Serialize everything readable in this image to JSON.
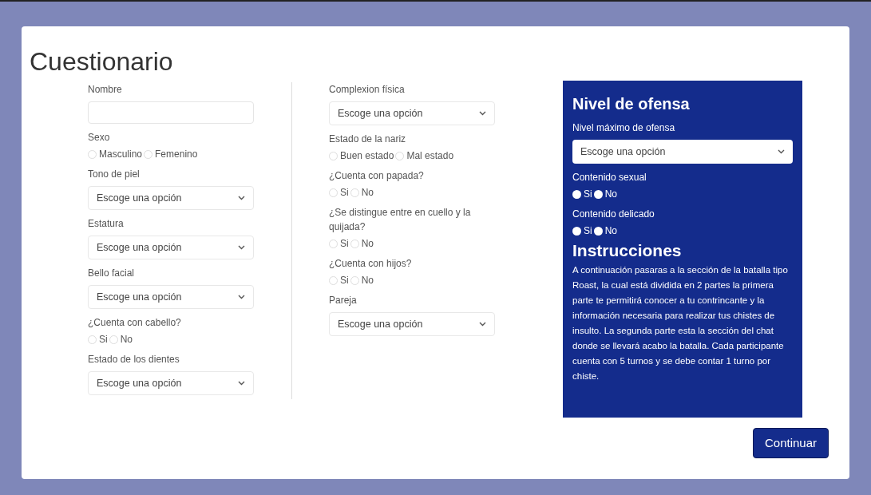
{
  "title": "Cuestionario",
  "columns": [
    [
      {
        "kind": "text",
        "label": "Nombre"
      },
      {
        "kind": "radio",
        "label": "Sexo",
        "options": [
          {
            "label": "Masculino",
            "checked": false
          },
          {
            "label": "Femenino",
            "checked": false
          }
        ]
      },
      {
        "kind": "select",
        "label": "Tono de piel",
        "placeholder": "Escoge una opción"
      },
      {
        "kind": "select",
        "label": "Estatura",
        "placeholder": "Escoge una opción"
      },
      {
        "kind": "select",
        "label": "Bello facial",
        "placeholder": "Escoge una opción"
      },
      {
        "kind": "radio",
        "label": "¿Cuenta con cabello?",
        "options": [
          {
            "label": "Si",
            "checked": false
          },
          {
            "label": "No",
            "checked": false
          }
        ]
      },
      {
        "kind": "select",
        "label": "Estado de los dientes",
        "placeholder": "Escoge una opción"
      }
    ],
    [
      {
        "kind": "select",
        "label": "Complexion física",
        "placeholder": "Escoge una opción"
      },
      {
        "kind": "radio",
        "label": "Estado de la nariz",
        "options": [
          {
            "label": "Buen estado",
            "checked": false
          },
          {
            "label": "Mal estado",
            "checked": false
          }
        ]
      },
      {
        "kind": "radio",
        "label": "¿Cuenta con papada?",
        "options": [
          {
            "label": "Si",
            "checked": false
          },
          {
            "label": "No",
            "checked": false
          }
        ]
      },
      {
        "kind": "radio",
        "label": "¿Se distingue entre en cuello y la quijada?",
        "options": [
          {
            "label": "Si",
            "checked": false
          },
          {
            "label": "No",
            "checked": false
          }
        ]
      },
      {
        "kind": "radio",
        "label": "¿Cuenta con hijos?",
        "options": [
          {
            "label": "Si",
            "checked": false
          },
          {
            "label": "No",
            "checked": false
          }
        ]
      },
      {
        "kind": "select",
        "label": "Pareja",
        "placeholder": "Escoge una opción"
      }
    ]
  ],
  "panel": {
    "heading": "Nivel de ofensa",
    "fields": [
      {
        "kind": "select",
        "label": "Nivel máximo de ofensa",
        "placeholder": "Escoge una opción"
      },
      {
        "kind": "radio",
        "label": "Contenido sexual",
        "options": [
          {
            "label": "Si",
            "checked": false
          },
          {
            "label": "No",
            "checked": false
          }
        ]
      },
      {
        "kind": "radio",
        "label": "Contenido delicado",
        "options": [
          {
            "label": "Si",
            "checked": false
          },
          {
            "label": "No",
            "checked": false
          }
        ]
      }
    ],
    "instructions_heading": "Instrucciones",
    "instructions": "A continuación pasaras a la sección de la batalla tipo Roast, la cual está dividida en 2 partes la primera parte te permitirá conocer a tu contrincante y la información necesaria para realizar tus chistes de insulto. La segunda parte esta la sección del chat donde se llevará acabo la batalla. Cada participante cuenta con 5 turnos y se debe contar 1 turno por chiste."
  },
  "button": "Continuar"
}
